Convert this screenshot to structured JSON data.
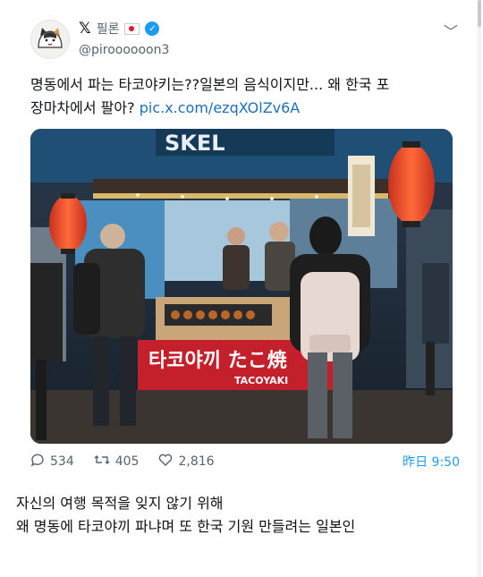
{
  "post": {
    "display_name": "필론",
    "flag_icon": "japan-flag-icon",
    "verified_icon": "verified-badge-icon",
    "handle": "@piroooooon3",
    "text_line1": "명동에서 파는 타코야키는??일본의 음식이지만... 왜 한국 포",
    "text_line2_prefix": "장마차에서 팔아? ",
    "link": "pic.x.com/ezqXOlZv6A",
    "stats": {
      "replies": "534",
      "reposts": "405",
      "likes": "2,816"
    },
    "timestamp": "昨日 9:50",
    "colors": {
      "link": "#1d6fb8",
      "accent": "#1d9bf0",
      "muted": "#536471"
    }
  },
  "media": {
    "sign_top": "SKEL",
    "banner_text": "타코야끼 たこ焼",
    "banner_sub": "TACOYAKI"
  },
  "caption": {
    "line1": "자신의 여행 목적을 잊지 않기 위해",
    "line2": "왜 명동에 타코야끼 파냐며 또 한국 기원 만들려는 일본인"
  }
}
